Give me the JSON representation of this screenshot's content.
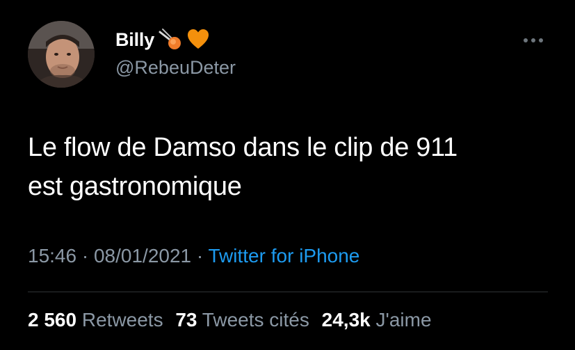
{
  "user": {
    "display_name": "Billy",
    "handle": "@RebeuDeter",
    "emoji_names": [
      "shooting-star-icon",
      "orange-heart-icon"
    ]
  },
  "tweet": {
    "text_line1": "Le flow de Damso dans le clip de 911",
    "text_line2": "est gastronomique",
    "time": "15:46",
    "separator": "·",
    "date": "08/01/2021",
    "source": "Twitter for iPhone"
  },
  "stats": {
    "retweets_count": "2 560",
    "retweets_label": "Retweets",
    "quotes_count": "73",
    "quotes_label": "Tweets cités",
    "likes_count": "24,3k",
    "likes_label": "J'aime"
  },
  "colors": {
    "background": "#000000",
    "text": "#ffffff",
    "secondary": "#8b98a5",
    "link": "#1d9bf0",
    "divider": "#2f3336",
    "heart": "#f4900c"
  }
}
